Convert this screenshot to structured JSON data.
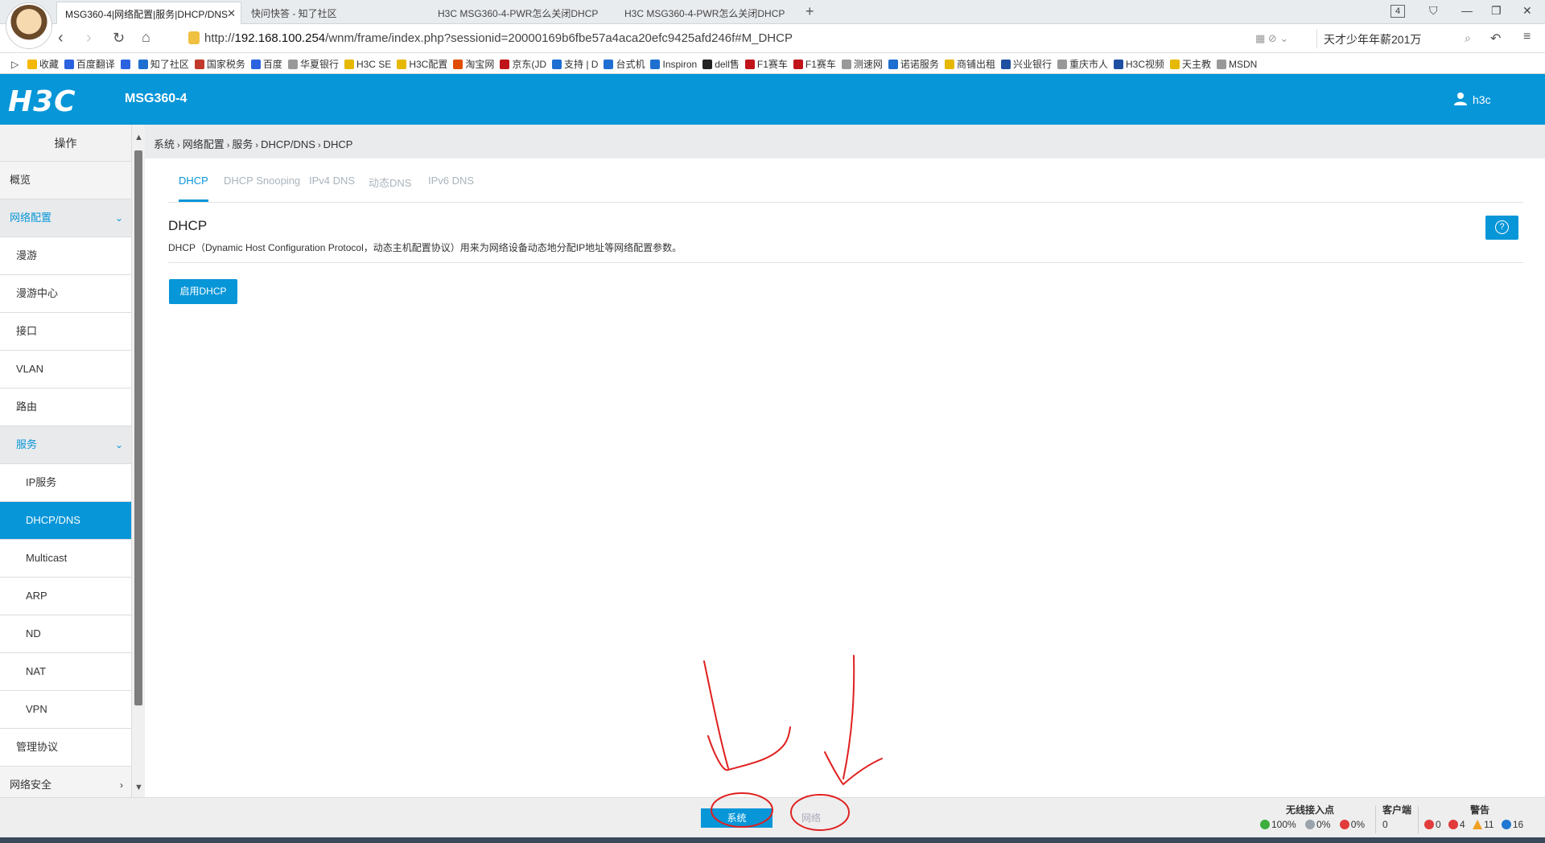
{
  "browser": {
    "tabs": [
      {
        "label": "MSG360-4|网络配置|服务|DHCP/DNS"
      },
      {
        "label": "快问快答 - 知了社区"
      },
      {
        "label": "H3C MSG360-4-PWR怎么关闭DHCP"
      },
      {
        "label": "H3C MSG360-4-PWR怎么关闭DHCP"
      }
    ],
    "tab_count": "4",
    "url_prefix": "http://",
    "url_host": "192.168.100.254",
    "url_path": "/wnm/frame/index.php?sessionid=20000169b6fbe57a4aca20efc9425afd246f#M_DHCP",
    "search_text": "天才少年年薪201万",
    "bookmarks": [
      {
        "label": "收藏",
        "color": "#f5b800"
      },
      {
        "label": "百度翻译",
        "color": "#2b62e0"
      },
      {
        "label": "",
        "color": "#2b62e0"
      },
      {
        "label": "知了社区",
        "color": "#1f6fd1"
      },
      {
        "label": "国家税务",
        "color": "#c0392b"
      },
      {
        "label": "百度",
        "color": "#2b62e0"
      },
      {
        "label": "华夏银行",
        "color": "#999999"
      },
      {
        "label": "H3C SE",
        "color": "#e6b800"
      },
      {
        "label": "H3C配置",
        "color": "#e6b800"
      },
      {
        "label": "淘宝网",
        "color": "#e04e00"
      },
      {
        "label": "京东(JD",
        "color": "#c0141a"
      },
      {
        "label": "支持 | D",
        "color": "#1f6fd1"
      },
      {
        "label": "台式机",
        "color": "#1f6fd1"
      },
      {
        "label": "Inspiron",
        "color": "#1f6fd1"
      },
      {
        "label": "dell售",
        "color": "#222222"
      },
      {
        "label": "F1赛车",
        "color": "#c0141a"
      },
      {
        "label": "F1赛车",
        "color": "#c0141a"
      },
      {
        "label": "测速网",
        "color": "#999999"
      },
      {
        "label": "诺诺服务",
        "color": "#1f6fd1"
      },
      {
        "label": "商铺出租",
        "color": "#e6b800"
      },
      {
        "label": "兴业银行",
        "color": "#1f4fa1"
      },
      {
        "label": "重庆市人",
        "color": "#999999"
      },
      {
        "label": "H3C视频",
        "color": "#1f4fa1"
      },
      {
        "label": "天主教",
        "color": "#e6b800"
      },
      {
        "label": "MSDN",
        "color": "#999999"
      }
    ]
  },
  "header": {
    "logo_text": "H3C",
    "model": "MSG360-4",
    "user": "h3c"
  },
  "sidebar": {
    "title": "操作",
    "items": [
      {
        "label": "概览",
        "level": 1
      },
      {
        "label": "网络配置",
        "level": 1
      },
      {
        "label": "漫游",
        "level": 2
      },
      {
        "label": "漫游中心",
        "level": 2
      },
      {
        "label": "接口",
        "level": 2
      },
      {
        "label": "VLAN",
        "level": 2
      },
      {
        "label": "路由",
        "level": 2
      },
      {
        "label": "服务",
        "level": 2
      },
      {
        "label": "IP服务",
        "level": 3
      },
      {
        "label": "DHCP/DNS",
        "level": 3
      },
      {
        "label": "Multicast",
        "level": 3
      },
      {
        "label": "ARP",
        "level": 3
      },
      {
        "label": "ND",
        "level": 3
      },
      {
        "label": "NAT",
        "level": 3
      },
      {
        "label": "VPN",
        "level": 3
      },
      {
        "label": "管理协议",
        "level": 2
      },
      {
        "label": "网络安全",
        "level": 1
      }
    ]
  },
  "breadcrumb": [
    "系统",
    "网络配置",
    "服务",
    "DHCP/DNS",
    "DHCP"
  ],
  "main": {
    "tabs": [
      "DHCP",
      "DHCP Snooping",
      "IPv4 DNS",
      "动态DNS",
      "IPv6 DNS"
    ],
    "title": "DHCP",
    "description": "DHCP（Dynamic Host Configuration Protocol，动态主机配置协议）用来为网络设备动态地分配IP地址等网络配置参数。",
    "enable_button": "启用DHCP",
    "help_icon": "?"
  },
  "statusbar": {
    "system_button": "系统",
    "network_button": "网络",
    "ap_label": "无线接入点",
    "ap_stats": [
      "100%",
      "0%",
      "0%"
    ],
    "client_label": "客户端",
    "client_count": "0",
    "alarm_label": "警告",
    "alarm_stats": [
      "0",
      "4",
      "11",
      "16"
    ],
    "colors": {
      "green": "#3dae3d",
      "gray": "#9aa3ab",
      "red": "#e23b3b",
      "orange": "#f0a020",
      "blue": "#1f78d1"
    }
  }
}
